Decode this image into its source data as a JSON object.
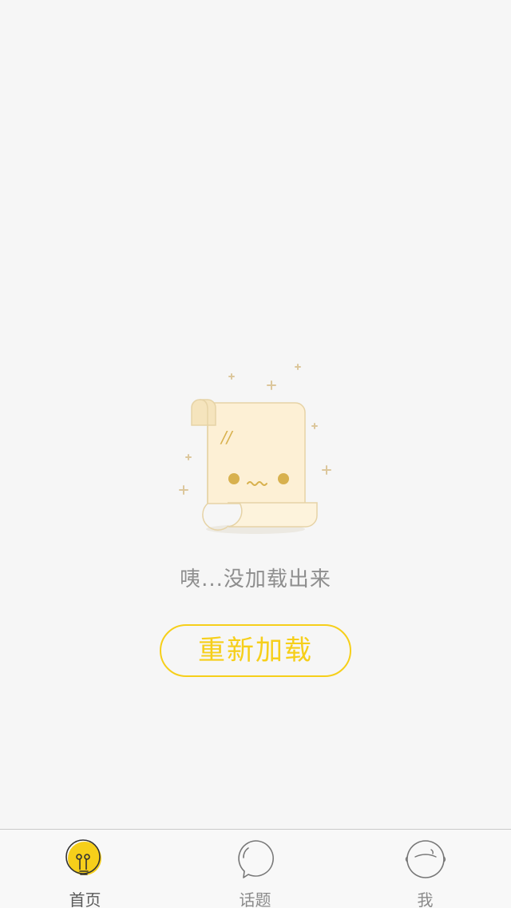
{
  "empty_state": {
    "message": "咦...没加载出来",
    "reload_label": "重新加载",
    "illustration_marks": "//"
  },
  "tab_bar": {
    "active_tab": "home",
    "tabs": [
      {
        "id": "home",
        "label": "首页",
        "icon": "lightbulb-icon"
      },
      {
        "id": "topics",
        "label": "话题",
        "icon": "speech-bubble-icon"
      },
      {
        "id": "me",
        "label": "我",
        "icon": "face-icon"
      }
    ]
  },
  "colors": {
    "accent": "#f6cf1a",
    "background": "#f6f6f6",
    "message_text": "#8e8e8e",
    "scroll_fill": "#fdf0d5",
    "scroll_stroke": "#e6d3a6",
    "sparkle": "#dcc79c",
    "face": "#d8b14e"
  }
}
